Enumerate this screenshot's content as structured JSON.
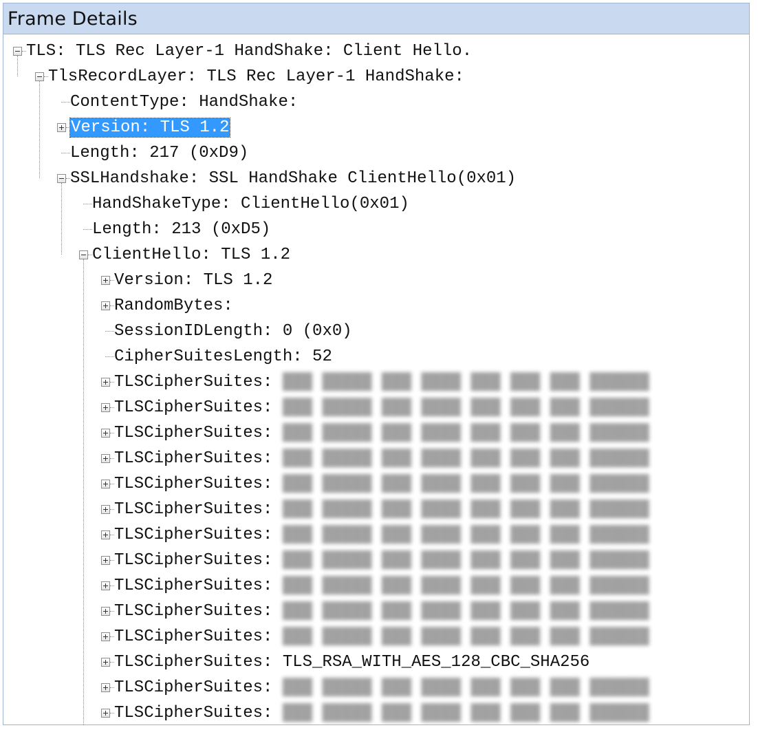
{
  "panel": {
    "title": "Frame Details"
  },
  "rows": [
    {
      "label": "TLS: TLS Rec Layer-1 HandShake: Client Hello.",
      "level": 0,
      "expander": "minus"
    },
    {
      "label": "TlsRecordLayer: TLS Rec Layer-1 HandShake:",
      "level": 1,
      "expander": "minus"
    },
    {
      "label": "ContentType: HandShake:",
      "level": 2,
      "expander": "none"
    },
    {
      "label": "Version: TLS 1.2",
      "level": 2,
      "expander": "plus",
      "selected": true
    },
    {
      "label": "Length: 217 (0xD9)",
      "level": 2,
      "expander": "none"
    },
    {
      "label": "SSLHandshake: SSL HandShake ClientHello(0x01)",
      "level": 2,
      "expander": "minus"
    },
    {
      "label": "HandShakeType: ClientHello(0x01)",
      "level": 3,
      "expander": "none"
    },
    {
      "label": "Length: 213 (0xD5)",
      "level": 3,
      "expander": "none"
    },
    {
      "label": "ClientHello: TLS 1.2",
      "level": 3,
      "expander": "minus"
    },
    {
      "label": "Version: TLS 1.2",
      "level": 4,
      "expander": "plus"
    },
    {
      "label": "RandomBytes:",
      "level": 4,
      "expander": "plus"
    },
    {
      "label": "SessionIDLength: 0 (0x0)",
      "level": 4,
      "expander": "none"
    },
    {
      "label": "CipherSuitesLength: 52",
      "level": 4,
      "expander": "none"
    },
    {
      "label": "TLSCipherSuites: ",
      "value": "",
      "level": 4,
      "expander": "plus",
      "blurred": true
    },
    {
      "label": "TLSCipherSuites: ",
      "value": "",
      "level": 4,
      "expander": "plus",
      "blurred": true
    },
    {
      "label": "TLSCipherSuites: ",
      "value": "",
      "level": 4,
      "expander": "plus",
      "blurred": true
    },
    {
      "label": "TLSCipherSuites: ",
      "value": "",
      "level": 4,
      "expander": "plus",
      "blurred": true
    },
    {
      "label": "TLSCipherSuites: ",
      "value": "",
      "level": 4,
      "expander": "plus",
      "blurred": true
    },
    {
      "label": "TLSCipherSuites: ",
      "value": "",
      "level": 4,
      "expander": "plus",
      "blurred": true
    },
    {
      "label": "TLSCipherSuites: ",
      "value": "",
      "level": 4,
      "expander": "plus",
      "blurred": true
    },
    {
      "label": "TLSCipherSuites: ",
      "value": "",
      "level": 4,
      "expander": "plus",
      "blurred": true
    },
    {
      "label": "TLSCipherSuites: ",
      "value": "",
      "level": 4,
      "expander": "plus",
      "blurred": true
    },
    {
      "label": "TLSCipherSuites: ",
      "value": "",
      "level": 4,
      "expander": "plus",
      "blurred": true
    },
    {
      "label": "TLSCipherSuites: ",
      "value": "",
      "level": 4,
      "expander": "plus",
      "blurred": true
    },
    {
      "label": "TLSCipherSuites: ",
      "value": "TLS_RSA_WITH_AES_128_CBC_SHA256",
      "level": 4,
      "expander": "plus"
    },
    {
      "label": "TLSCipherSuites: ",
      "value": "",
      "level": 4,
      "expander": "plus",
      "blurred": true
    },
    {
      "label": "TLSCipherSuites: ",
      "value": "",
      "level": 4,
      "expander": "plus",
      "blurred": true
    }
  ],
  "blurred_placeholder": "███ █████ ███ ████ ███ ███ ███ ██████",
  "colors": {
    "header_bg": "#c8d9f0",
    "selection_bg": "#3399ff",
    "selection_fg": "#ffffff"
  }
}
